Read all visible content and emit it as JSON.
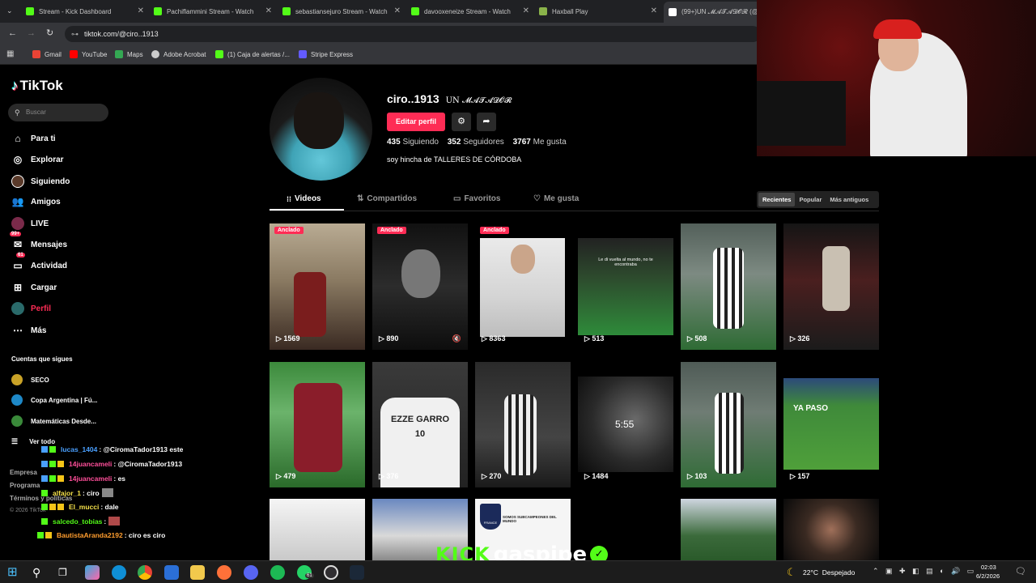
{
  "browser": {
    "tabs": [
      {
        "title": "Stream - Kick Dashboard",
        "color": "#53fc18"
      },
      {
        "title": "Pachiflammini Stream - Watch",
        "color": "#53fc18"
      },
      {
        "title": "sebastiansejuro Stream - Watch",
        "color": "#53fc18"
      },
      {
        "title": "davooxeneize Stream - Watch",
        "color": "#53fc18"
      },
      {
        "title": "Haxball Play",
        "color": "#8ab34a"
      },
      {
        "title": "(99+)UN 𝓜𝓐𝓣𝓐𝓓𝓞𝓡 (@ci",
        "color": "#ffffff"
      }
    ],
    "url": "tiktok.com/@ciro..1913",
    "bookmarks": [
      {
        "label": "Gmail",
        "color": "#ea4335"
      },
      {
        "label": "YouTube",
        "color": "#ff0000"
      },
      {
        "label": "Maps",
        "color": "#34a853"
      },
      {
        "label": "Adobe Acrobat",
        "color": "#cccccc"
      },
      {
        "label": "(1) Caja de alertas /...",
        "color": "#53fc18"
      },
      {
        "label": "Stripe Express",
        "color": "#635bff"
      }
    ]
  },
  "sidebar": {
    "logo": "TikTok",
    "search_placeholder": "Buscar",
    "nav": [
      {
        "label": "Para ti",
        "icon": "home-icon"
      },
      {
        "label": "Explorar",
        "icon": "compass-icon"
      },
      {
        "label": "Siguiendo",
        "icon": "following-icon"
      },
      {
        "label": "Amigos",
        "icon": "friends-icon"
      },
      {
        "label": "LIVE",
        "icon": "live-icon"
      },
      {
        "label": "Mensajes",
        "icon": "messages-icon",
        "badge": "99+"
      },
      {
        "label": "Actividad",
        "icon": "activity-icon",
        "badge": "61"
      },
      {
        "label": "Cargar",
        "icon": "upload-icon"
      },
      {
        "label": "Perfil",
        "icon": "profile-icon"
      },
      {
        "label": "Más",
        "icon": "more-icon"
      }
    ],
    "following_title": "Cuentas que sigues",
    "following": [
      "SECO",
      "Copa Argentina | Fú...",
      "Matemáticas Desde..."
    ],
    "see_all": "Ver todo",
    "footer": [
      "Empresa",
      "Programa",
      "Términos y políticas",
      "© 2026 TikTok"
    ]
  },
  "profile": {
    "username": "ciro..1913",
    "display_name": "UN 𝓜𝓐𝓣𝓐𝓓𝓞𝓡",
    "edit_button": "Editar perfil",
    "following_count": "435",
    "following_label": "Siguiendo",
    "followers_count": "352",
    "followers_label": "Seguidores",
    "likes_count": "3767",
    "likes_label": "Me gusta",
    "bio": "soy hincha de TALLERES DE CÓRDOBA"
  },
  "content_tabs": [
    "Videos",
    "Compartidos",
    "Favoritos",
    "Me gusta"
  ],
  "sort": [
    "Recientes",
    "Popular",
    "Más antiguos"
  ],
  "pinned_label": "Anclado",
  "videos_row1": [
    {
      "views": "1569",
      "pinned": true
    },
    {
      "views": "890",
      "pinned": true
    },
    {
      "views": "8363",
      "pinned": true
    },
    {
      "views": "513",
      "caption": "Le di vuelta al mundo, no te encontraba"
    },
    {
      "views": "508"
    },
    {
      "views": "326"
    }
  ],
  "videos_row2": [
    {
      "views": "479"
    },
    {
      "views": "376"
    },
    {
      "views": "270"
    },
    {
      "views": "1484"
    },
    {
      "views": "103"
    },
    {
      "views": "157",
      "caption": "YA PASO"
    }
  ],
  "video_time": "5:55",
  "shirt_text": "EZZE GARRO 10",
  "row3_captions": [
    "FRANCE",
    "SOMOS SUBCAMPEONES DEL MUNDO"
  ],
  "chat": [
    {
      "user": "lucas_1404",
      "msg": ": @CiromaTador1913 este",
      "color": "#4aa0ff"
    },
    {
      "user": "14juancameli",
      "msg": ": @CiromaTador1913",
      "color": "#ff4f9a"
    },
    {
      "user": "14juancameli",
      "msg": ": es",
      "color": "#ff4f9a"
    },
    {
      "user": "alfajor_1",
      "msg": ": ciro",
      "color": "#f5e14a"
    },
    {
      "user": "El_mucci",
      "msg": ": dale",
      "color": "#f5e14a"
    },
    {
      "user": "salcedo_tobias",
      "msg": ":",
      "color": "#53fc18"
    },
    {
      "user": "BautistaAranda2192",
      "msg": ": ciro es ciro",
      "color": "#ff9d2e"
    }
  ],
  "stream_overlay": {
    "brand": "KICK",
    "name": "gaspipe"
  },
  "taskbar": {
    "weather": "22°C  Despejado",
    "time": "02:03",
    "date": "6/2/2026",
    "whatsapp_badge": "61"
  }
}
